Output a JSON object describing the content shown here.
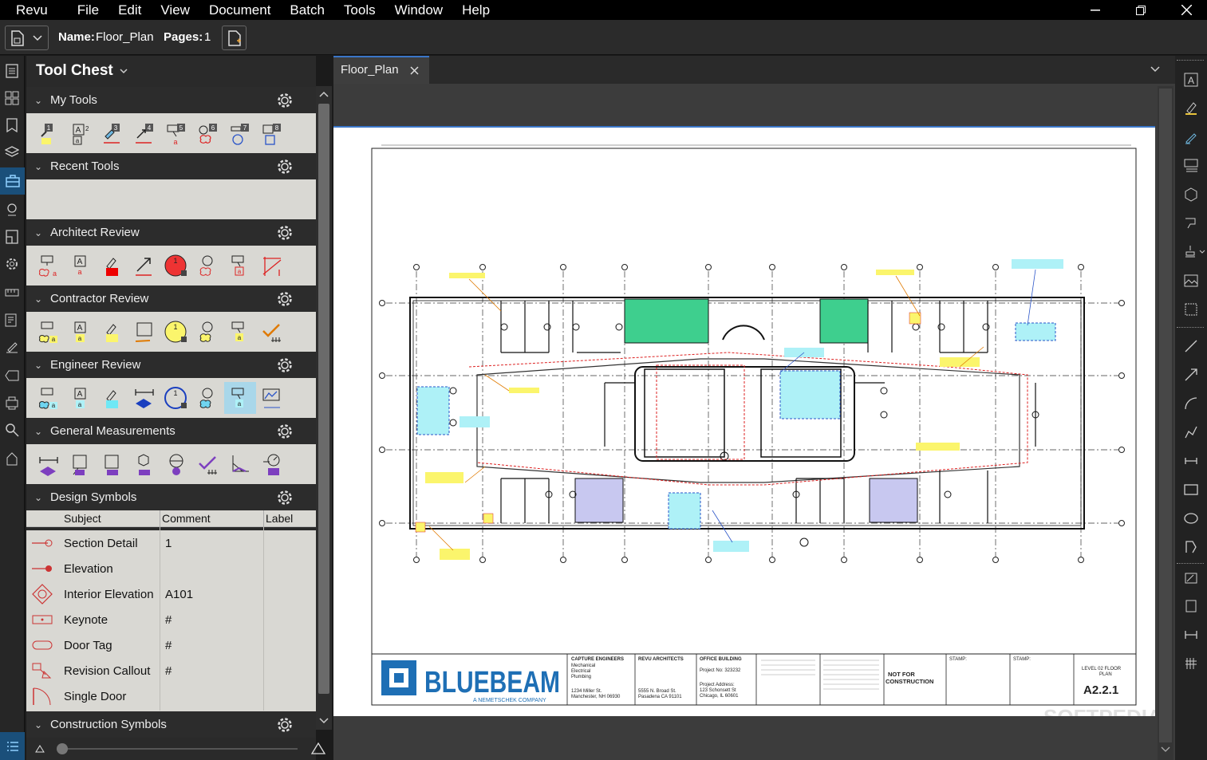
{
  "menu": [
    "Revu",
    "File",
    "Edit",
    "View",
    "Document",
    "Batch",
    "Tools",
    "Window",
    "Help"
  ],
  "doc": {
    "name_label": "Name:",
    "name": "Floor_Plan",
    "pages_label": "Pages:",
    "pages": "1"
  },
  "panel": {
    "title": "Tool Chest",
    "sections": {
      "my_tools": "My Tools",
      "recent": "Recent Tools",
      "architect": "Architect Review",
      "contractor": "Contractor Review",
      "engineer": "Engineer Review",
      "general": "General Measurements",
      "design": "Design Symbols",
      "construction": "Construction Symbols"
    },
    "my_tool_numbers": [
      "1",
      "2",
      "3",
      "4",
      "5",
      "6",
      "7",
      "8"
    ],
    "table": {
      "headers": [
        "Subject",
        "Comment",
        "Label"
      ],
      "rows": [
        {
          "subject": "Section Detail",
          "comment": "1"
        },
        {
          "subject": "Elevation",
          "comment": ""
        },
        {
          "subject": "Interior Elevation",
          "comment": "A101"
        },
        {
          "subject": "Keynote",
          "comment": "#"
        },
        {
          "subject": "Door Tag",
          "comment": "#"
        },
        {
          "subject": "Revision Callout",
          "comment": "#"
        },
        {
          "subject": "Single Door",
          "comment": ""
        }
      ]
    }
  },
  "tab": {
    "title": "Floor_Plan"
  },
  "drawing": {
    "logo": "BLUEBEAM",
    "logo_sub": "A NEMETSCHEK COMPANY",
    "tb1_title": "CAPTURE ENGINEERS",
    "tb1_lines": "Mechanical\nElectrical\nPlumbing",
    "tb1_addr": "1234 Miller St.\nManchester, NH 06930",
    "tb2_title": "REVU ARCHITECTS",
    "tb2_addr": "5555 N. Broad St.\nPasadena CA 91101",
    "tb3_title": "OFFICE BUILDING",
    "tb3_proj": "Project No: 323232",
    "tb3_addr": "Project Address:\n123 Schonsett St\nChicago, IL 60601",
    "nfc": "NOT FOR CONSTRUCTION",
    "stamp": "STAMP:",
    "sheet_level": "LEVEL 02 FLOOR PLAN",
    "sheet_no": "A2.2.1",
    "watermark": "SOFTPEDIA"
  },
  "colors": {
    "accent": "#1e6fb5",
    "green": "#3ecf8e",
    "lavender": "#c8c8f0",
    "yellow": "#fbf56c",
    "cyan": "#aef1f7"
  }
}
